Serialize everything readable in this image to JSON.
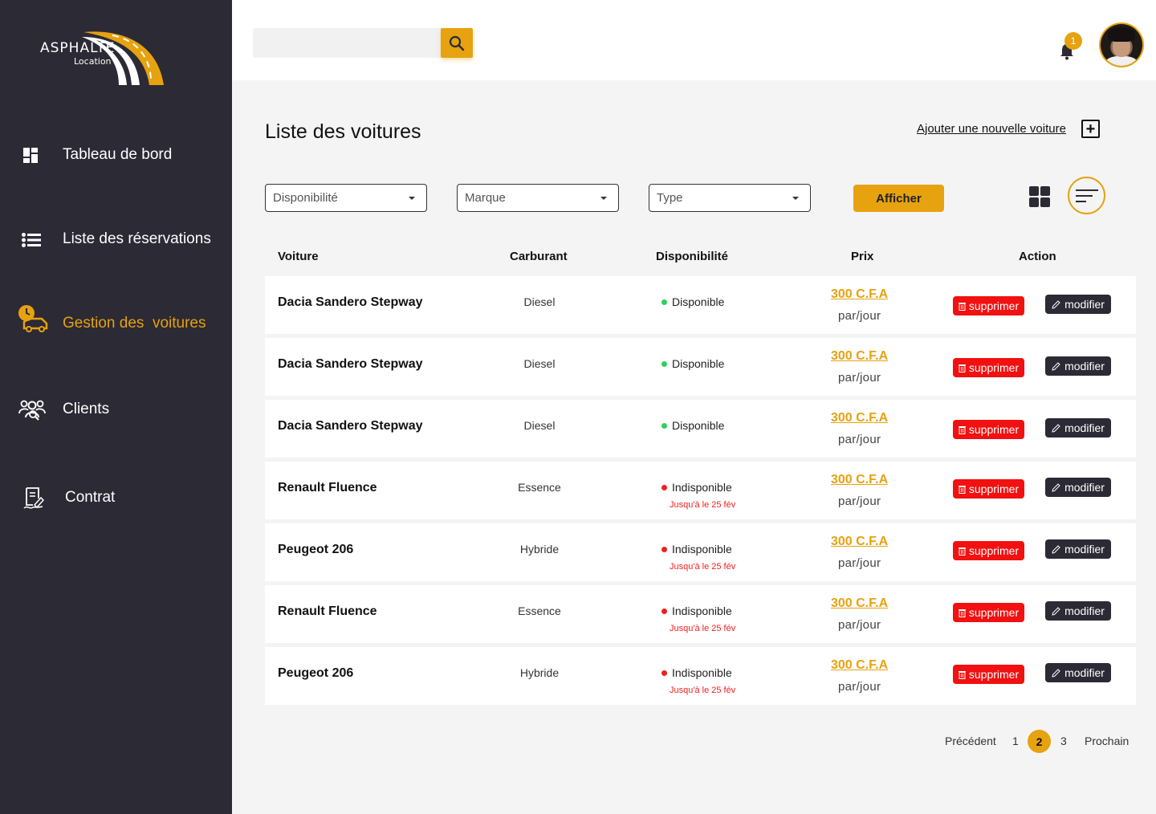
{
  "brand": {
    "name": "ASPHALTE",
    "sub": "Location",
    "accent": "#e6a20f",
    "dark": "#2b2a35"
  },
  "sidebar": {
    "items": [
      {
        "label": "Tableau de bord",
        "icon": "dashboard-icon",
        "active": false
      },
      {
        "label": "Liste des réservations",
        "icon": "list-icon",
        "active": false
      },
      {
        "label": "Gestion des  voitures",
        "icon": "car-clock-icon",
        "active": true
      },
      {
        "label": "Clients",
        "icon": "clients-icon",
        "active": false
      },
      {
        "label": "Contrat",
        "icon": "contract-icon",
        "active": false
      }
    ]
  },
  "topbar": {
    "search": {
      "placeholder": "",
      "value": ""
    },
    "notifications": {
      "count": "1"
    }
  },
  "main": {
    "title": "Liste des voitures",
    "add_label": "Ajouter une nouvelle voiture",
    "add_icon": "+",
    "filters": {
      "availability": "Disponibilité",
      "brand": "Marque",
      "type": "Type",
      "submit": "Afficher"
    },
    "table": {
      "headers": {
        "car": "Voiture",
        "fuel": "Carburant",
        "availability": "Disponibilité",
        "price": "Prix",
        "action": "Action"
      },
      "delete_label": "supprimer",
      "edit_label": "modifier",
      "rows": [
        {
          "car": "Dacia Sandero Stepway",
          "fuel": "Diesel",
          "status": "Disponible",
          "available": true,
          "until": "",
          "price": "300 C.F.A",
          "per": "par/jour"
        },
        {
          "car": "Dacia Sandero Stepway",
          "fuel": "Diesel",
          "status": "Disponible",
          "available": true,
          "until": "",
          "price": "300 C.F.A",
          "per": "par/jour"
        },
        {
          "car": "Dacia Sandero Stepway",
          "fuel": "Diesel",
          "status": "Disponible",
          "available": true,
          "until": "",
          "price": "300 C.F.A",
          "per": "par/jour"
        },
        {
          "car": "Renault Fluence",
          "fuel": "Essence",
          "status": "Indisponible",
          "available": false,
          "until": "Jusqu'à le 25 fév",
          "price": "300 C.F.A",
          "per": "par/jour"
        },
        {
          "car": "Peugeot 206",
          "fuel": "Hybride",
          "status": "Indisponible",
          "available": false,
          "until": "Jusqu'à le 25 fév",
          "price": "300 C.F.A",
          "per": "par/jour"
        },
        {
          "car": "Renault Fluence",
          "fuel": "Essence",
          "status": "Indisponible",
          "available": false,
          "until": "Jusqu'à le 25 fév",
          "price": "300 C.F.A",
          "per": "par/jour"
        },
        {
          "car": "Peugeot 206",
          "fuel": "Hybride",
          "status": "Indisponible",
          "available": false,
          "until": "Jusqu'à le 25 fév",
          "price": "300 C.F.A",
          "per": "par/jour"
        }
      ]
    },
    "pagination": {
      "prev": "Précédent",
      "pages": [
        "1",
        "2",
        "3"
      ],
      "current": "2",
      "next": "Prochain"
    }
  }
}
